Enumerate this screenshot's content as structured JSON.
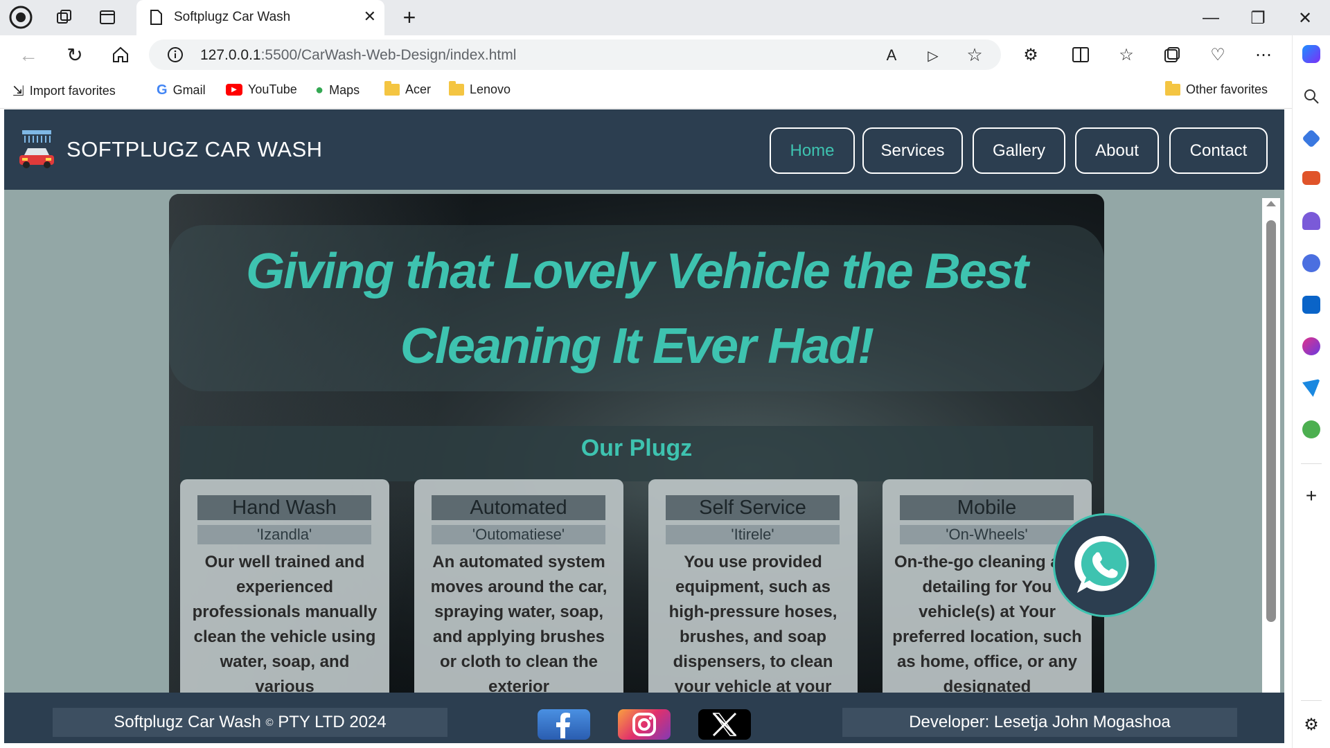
{
  "browser": {
    "tab_title": "Softplugz Car Wash",
    "url_host": "127.0.0.1",
    "url_path": ":5500/CarWash-Web-Design/index.html",
    "favorites": [
      "Import favorites",
      "Gmail",
      "YouTube",
      "Maps",
      "Acer",
      "Lenovo"
    ],
    "other_favorites": "Other favorites"
  },
  "site": {
    "brand": "SOFTPLUGZ CAR WASH",
    "nav": [
      "Home",
      "Services",
      "Gallery",
      "About",
      "Contact"
    ],
    "active_nav": "Home",
    "accent_color": "#3ec3b0",
    "header_color": "#2c3e50"
  },
  "hero": {
    "headline": "Giving that Lovely Vehicle the Best Cleaning It Ever Had!",
    "section_title": "Our Plugz"
  },
  "cards": [
    {
      "title": "Hand Wash",
      "subtitle": "'Izandla'",
      "text": "Our well trained and experienced professionals manually clean the vehicle using water, soap, and various"
    },
    {
      "title": "Automated",
      "subtitle": "'Outomatiese'",
      "text": "An automated system moves around the car, spraying water, soap, and applying brushes or cloth to clean the exterior"
    },
    {
      "title": "Self Service",
      "subtitle": "'Itirele'",
      "text": "You use provided equipment, such as high-pressure hoses, brushes, and soap dispensers, to clean your vehicle at your"
    },
    {
      "title": "Mobile",
      "subtitle": "'On-Wheels'",
      "text": "On-the-go cleaning and detailing for You vehicle(s) at Your preferred location, such as home, office, or any designated"
    }
  ],
  "footer": {
    "copyright_left": "Softplugz Car Wash",
    "copyright_symbol": "©",
    "copyright_right": "PTY LTD 2024",
    "developer": "Developer: Lesetja John Mogashoa"
  }
}
